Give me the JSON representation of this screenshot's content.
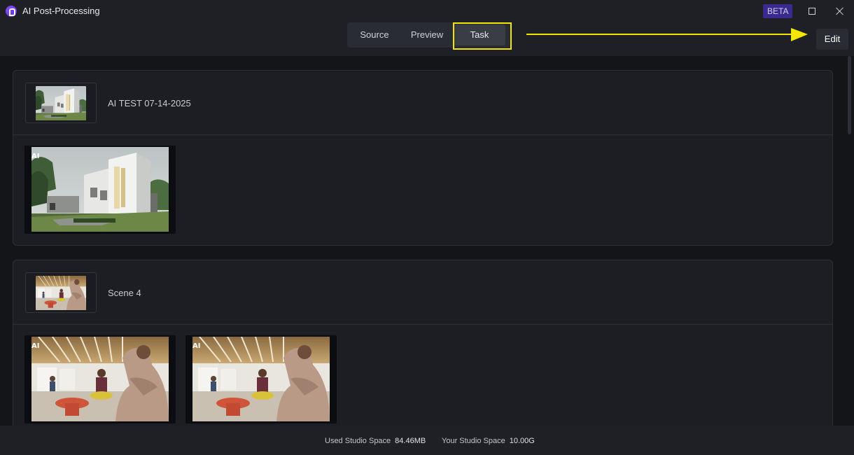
{
  "app": {
    "title": "AI Post-Processing",
    "beta_label": "BETA"
  },
  "tabs": [
    {
      "label": "Source",
      "active": false
    },
    {
      "label": "Preview",
      "active": false
    },
    {
      "label": "Task",
      "active": true
    }
  ],
  "edit_label": "Edit",
  "annotation": {
    "color": "#f5e600"
  },
  "tasks": [
    {
      "title": "AI TEST 07-14-2025",
      "thumbnail": "building-exterior-image",
      "results": [
        {
          "badge": "AI",
          "image": "building-exterior-image"
        }
      ]
    },
    {
      "title": "Scene 4",
      "thumbnail": "office-lounge-image",
      "results": [
        {
          "badge": "AI",
          "image": "office-lounge-image"
        },
        {
          "badge": "AI",
          "image": "office-lounge-image"
        }
      ]
    }
  ],
  "status": {
    "used_label": "Used Studio Space",
    "used_value": "84.46MB",
    "total_label": "Your Studio Space",
    "total_value": "10.00G"
  },
  "colors": {
    "background": "#141519",
    "topbar": "#1e2026",
    "accent": "#8a4dff",
    "beta_badge": "#3a2a8e"
  }
}
